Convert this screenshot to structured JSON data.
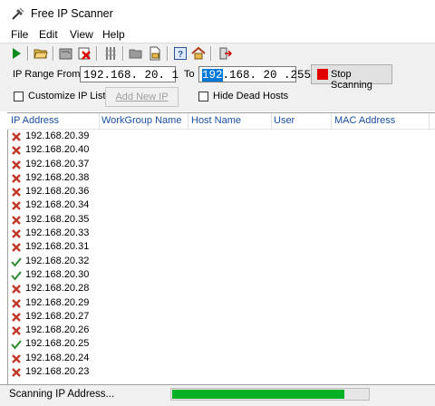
{
  "window": {
    "title": "Free IP Scanner"
  },
  "menu": [
    "File",
    "Edit",
    "View",
    "Help"
  ],
  "toolbar": {
    "icons": [
      "play-icon",
      "open-folder-icon",
      "save-icon",
      "delete-icon",
      "columns-icon",
      "folder-icon",
      "file-icon",
      "help-icon",
      "home-icon",
      "exit-icon"
    ]
  },
  "range": {
    "from_label": "IP Range From",
    "from_value": "192.168. 20. 1",
    "to_label": "To",
    "to_selected": "192",
    "to_rest": ".168. 20 .255",
    "stop_label": "Stop Scanning",
    "customize_label": "Customize IP List",
    "customize_checked": false,
    "add_new_label": "Add New IP",
    "hide_dead_label": "Hide Dead Hosts",
    "hide_dead_checked": false
  },
  "table": {
    "columns": [
      "IP Address",
      "WorkGroup Name",
      "Host Name",
      "User",
      "MAC Address"
    ],
    "rows": [
      {
        "ip": "192.168.20.39",
        "status": "dead"
      },
      {
        "ip": "192.168.20.40",
        "status": "dead"
      },
      {
        "ip": "192.168.20.37",
        "status": "dead"
      },
      {
        "ip": "192.168.20.38",
        "status": "dead"
      },
      {
        "ip": "192.168.20.36",
        "status": "dead"
      },
      {
        "ip": "192.168.20.34",
        "status": "dead"
      },
      {
        "ip": "192.168.20.35",
        "status": "dead"
      },
      {
        "ip": "192.168.20.33",
        "status": "dead"
      },
      {
        "ip": "192.168.20.31",
        "status": "dead"
      },
      {
        "ip": "192.168.20.32",
        "status": "alive"
      },
      {
        "ip": "192.168.20.30",
        "status": "alive"
      },
      {
        "ip": "192.168.20.28",
        "status": "dead"
      },
      {
        "ip": "192.168.20.29",
        "status": "dead"
      },
      {
        "ip": "192.168.20.27",
        "status": "dead"
      },
      {
        "ip": "192.168.20.26",
        "status": "dead"
      },
      {
        "ip": "192.168.20.25",
        "status": "alive"
      },
      {
        "ip": "192.168.20.24",
        "status": "dead"
      },
      {
        "ip": "192.168.20.23",
        "status": "dead"
      }
    ]
  },
  "status": {
    "text": "Scanning IP Address...",
    "progress": 0.88,
    "progress_color": "#06b025"
  },
  "colors": {
    "dead": "#c0392b",
    "alive": "#2e8b2e",
    "stop_red": "#e00000",
    "selection": "#0078d7"
  }
}
